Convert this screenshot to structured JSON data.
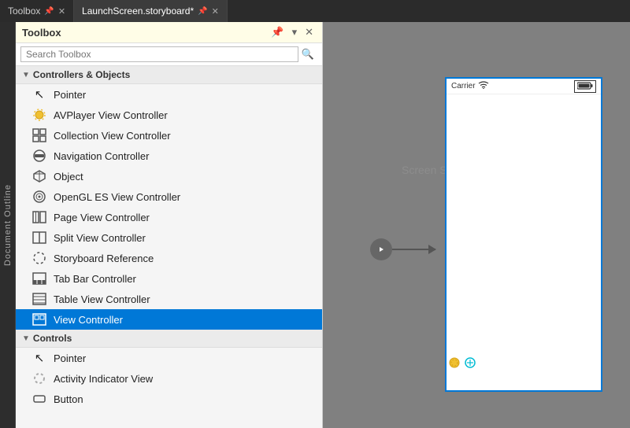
{
  "topbar": {
    "tabs": [
      {
        "id": "toolbox",
        "label": "Toolbox",
        "pin_icon": "📌",
        "close_icon": "✕",
        "active": false
      },
      {
        "id": "launchscreen",
        "label": "LaunchScreen.storyboard*",
        "pin_icon": "📌",
        "close_icon": "✕",
        "active": true
      }
    ]
  },
  "doc_outline": {
    "label": "Document Outline"
  },
  "toolbox": {
    "title": "Toolbox",
    "search_placeholder": "Search Toolbox",
    "groups": [
      {
        "id": "controllers-objects",
        "label": "Controllers & Objects",
        "expanded": true,
        "items": [
          {
            "id": "pointer1",
            "label": "Pointer",
            "icon": "cursor"
          },
          {
            "id": "avplayer",
            "label": "AVPlayer View Controller",
            "icon": "sun"
          },
          {
            "id": "collection",
            "label": "Collection View Controller",
            "icon": "grid"
          },
          {
            "id": "navigation",
            "label": "Navigation Controller",
            "icon": "nav"
          },
          {
            "id": "object",
            "label": "Object",
            "icon": "cube"
          },
          {
            "id": "opengl",
            "label": "OpenGL ES View Controller",
            "icon": "target"
          },
          {
            "id": "pageview",
            "label": "Page View Controller",
            "icon": "book"
          },
          {
            "id": "splitview",
            "label": "Split View Controller",
            "icon": "split"
          },
          {
            "id": "storyboard",
            "label": "Storyboard Reference",
            "icon": "circle-dashed"
          },
          {
            "id": "tabbar",
            "label": "Tab Bar Controller",
            "icon": "tabbar"
          },
          {
            "id": "tableview",
            "label": "Table View Controller",
            "icon": "table"
          },
          {
            "id": "viewcontroller",
            "label": "View Controller",
            "icon": "viewctrl",
            "selected": true
          }
        ]
      },
      {
        "id": "controls",
        "label": "Controls",
        "expanded": true,
        "items": [
          {
            "id": "pointer2",
            "label": "Pointer",
            "icon": "cursor"
          },
          {
            "id": "activityindicator",
            "label": "Activity Indicator View",
            "icon": "spinner"
          },
          {
            "id": "button",
            "label": "Button",
            "icon": "button"
          }
        ]
      }
    ]
  },
  "canvas": {
    "phone": {
      "carrier": "Carrier",
      "signal_icon": "▲",
      "battery_text": "■"
    },
    "storyboard_bg": "Screen S"
  },
  "colors": {
    "selected_bg": "#0078d7",
    "toolbox_header_bg": "#fffde7",
    "accent_blue": "#0078d7"
  }
}
